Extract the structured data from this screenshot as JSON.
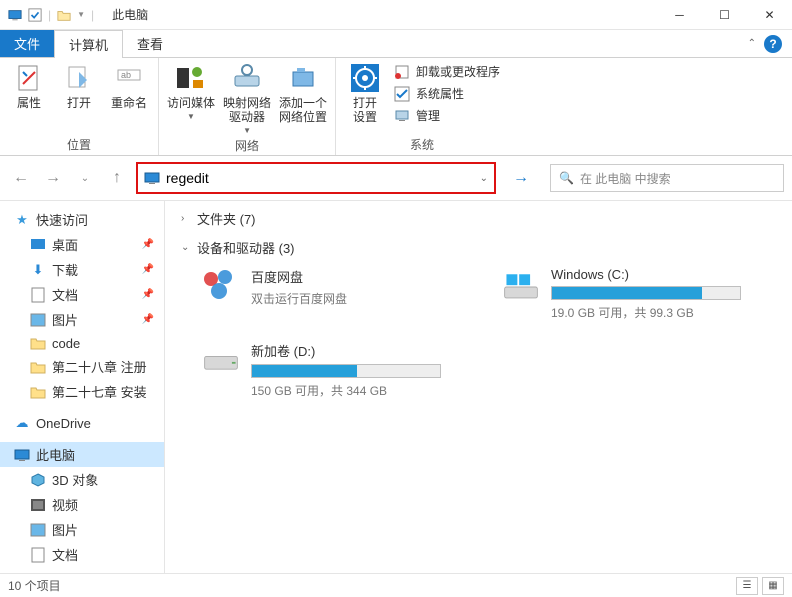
{
  "window": {
    "title": "此电脑"
  },
  "menutabs": {
    "file": "文件",
    "computer": "计算机",
    "view": "查看"
  },
  "ribbon": {
    "group_location": "位置",
    "group_network": "网络",
    "group_system": "系统",
    "properties": "属性",
    "open": "打开",
    "rename": "重命名",
    "access_media": "访问媒体",
    "map_drive": "映射网络\n驱动器",
    "add_location": "添加一个\n网络位置",
    "open_settings": "打开\n设置",
    "uninstall": "卸载或更改程序",
    "sys_props": "系统属性",
    "manage": "管理"
  },
  "addressbar": {
    "value": "regedit"
  },
  "search": {
    "placeholder": "在 此电脑 中搜索"
  },
  "sidebar": {
    "quick_access": "快速访问",
    "desktop": "桌面",
    "downloads": "下载",
    "documents": "文档",
    "pictures": "图片",
    "code": "code",
    "ch28": "第二十八章 注册",
    "ch27": "第二十七章 安装",
    "onedrive": "OneDrive",
    "this_pc": "此电脑",
    "objects3d": "3D 对象",
    "videos": "视频",
    "pictures2": "图片",
    "documents2": "文档"
  },
  "content": {
    "folders_header": "文件夹 (7)",
    "devices_header": "设备和驱动器 (3)",
    "baidu": {
      "name": "百度网盘",
      "sub": "双击运行百度网盘"
    },
    "c": {
      "name": "Windows (C:)",
      "sub": "19.0 GB 可用，共 99.3 GB",
      "fill": 80
    },
    "d": {
      "name": "新加卷 (D:)",
      "sub": "150 GB 可用，共 344 GB",
      "fill": 56
    }
  },
  "status": {
    "count": "10 个项目"
  }
}
